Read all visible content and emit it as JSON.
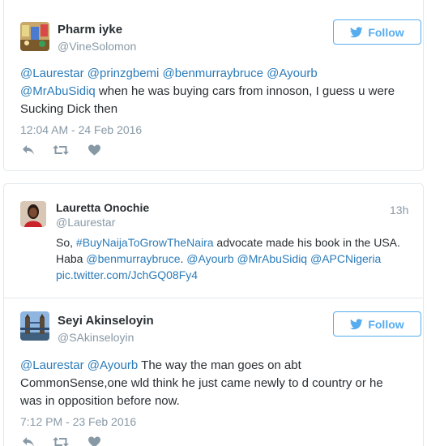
{
  "colors": {
    "link": "#2b7bb9",
    "follow": "#55acee",
    "meta": "#8899a6",
    "text": "#292f33"
  },
  "tweet1": {
    "name": "Pharm iyke",
    "handle": "@VineSolomon",
    "follow_label": "Follow",
    "mentions_line1": [
      "@Laurestar",
      "@prinzgbemi",
      "@benmurraybruce",
      "@Ayourb"
    ],
    "mention_line2": "@MrAbuSidiq",
    "text_line2": " when he was buying cars from innoson, I guess u were",
    "text_line3": "Sucking Dick then",
    "timestamp": "12:04 AM - 24 Feb 2016",
    "icons": [
      "reply-icon",
      "retweet-icon",
      "like-icon"
    ]
  },
  "quoted": {
    "name": "Lauretta Onochie",
    "handle": "@Laurestar",
    "time_ago": "13h",
    "text_pre": "So, ",
    "hashtag": "#BuyNaijaToGrowTheNaira",
    "text_mid": " advocate made his book in the USA.",
    "text_haba": "Haba ",
    "mention_bmb": "@benmurraybruce",
    "text_dot": ". ",
    "mention_ayourb": "@Ayourb",
    "mention_mas": "@MrAbuSidiq",
    "mention_apc": "@APCNigeria",
    "pic_link": "pic.twitter.com/JchGQ08Fy4"
  },
  "tweet2": {
    "name": "Seyi Akinseloyin",
    "handle": "@SAkinseloyin",
    "follow_label": "Follow",
    "mention1": "@Laurestar",
    "mention2": "@Ayourb",
    "text_line1": " The way the man goes on abt",
    "text_line2": "CommonSense,one wld think he just came newly to d country or he",
    "text_line3": "was in opposition before now.",
    "timestamp": "7:12 PM - 23 Feb 2016",
    "icons": [
      "reply-icon",
      "retweet-icon",
      "like-icon"
    ]
  }
}
